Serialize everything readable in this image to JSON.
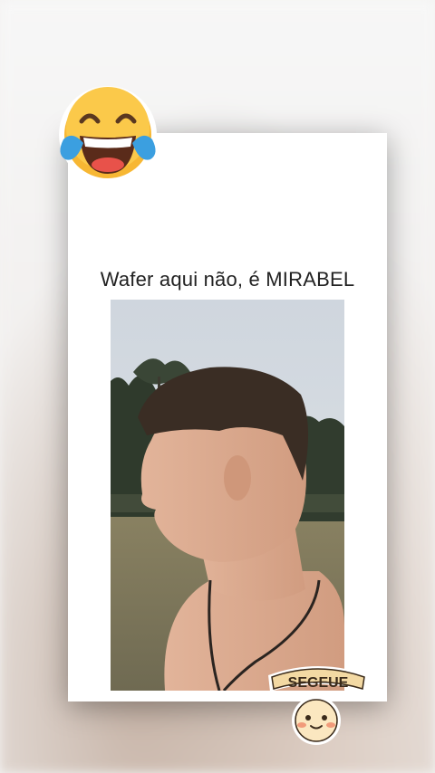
{
  "post": {
    "caption": "Wafer aqui não, é MIRABEL",
    "sticker_text": "SEGEUE"
  },
  "icons": {
    "top_left": "laughing-tears-emoji-icon",
    "bottom_right": "smiling-mascot-sticker-icon"
  },
  "colors": {
    "card": "#ffffff",
    "caption_text": "#222222",
    "emoji_yellow": "#f7b733",
    "tear_blue": "#3b9fe0"
  }
}
